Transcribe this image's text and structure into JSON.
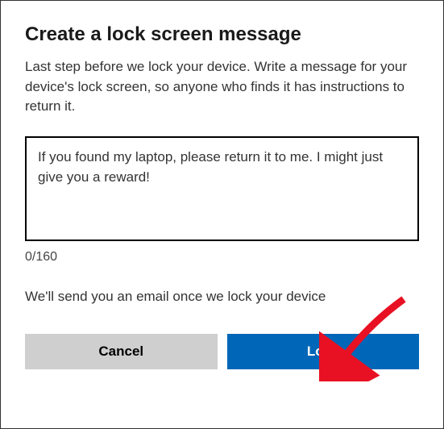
{
  "dialog": {
    "title": "Create a lock screen message",
    "description": "Last step before we lock your device. Write a message for your device's lock screen, so anyone who finds it has instructions to return it.",
    "textarea_value": "If you found my laptop, please return it to me. I might just give you a reward!",
    "counter": "0/160",
    "info": "We'll send you an email once we lock your device",
    "cancel_label": "Cancel",
    "lock_label": "Lock"
  }
}
